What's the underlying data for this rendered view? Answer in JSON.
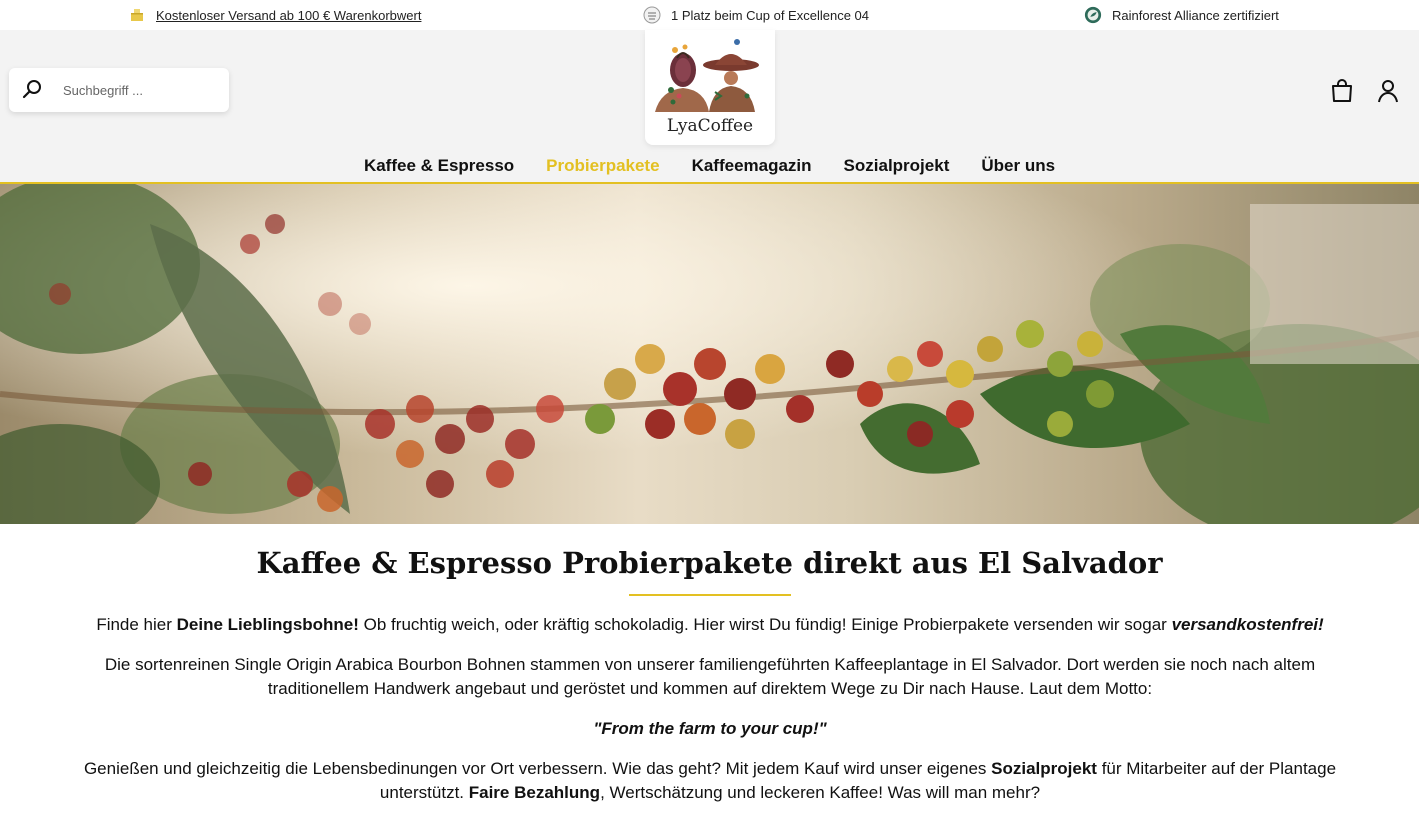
{
  "topbar": {
    "usp_shipping": "Kostenloser Versand ab 100 € Warenkorbwert",
    "usp_award": "1 Platz beim Cup of Excellence 04",
    "usp_rainforest": "Rainforest Alliance zertifiziert"
  },
  "header": {
    "search_placeholder": "Suchbegriff ...",
    "logo_text": "LyaCoffee"
  },
  "nav": {
    "items": [
      "Kaffee & Espresso",
      "Probierpakete",
      "Kaffeemagazin",
      "Sozialprojekt",
      "Über uns"
    ],
    "active": "Probierpakete"
  },
  "content": {
    "title": "Kaffee & Espresso Probierpakete direkt aus El Salvador",
    "p1": {
      "a": "Finde hier ",
      "b": "Deine Lieblingsbohne!",
      "c": " Ob fruchtig weich, oder kräftig schokoladig. Hier wirst Du fündig! Einige Probierpakete versenden wir sogar ",
      "d": "versandkostenfrei!"
    },
    "p2": "Die sortenreinen Single Origin Arabica Bourbon Bohnen stammen von unserer familiengeführten Kaffeeplantage in El Salvador. Dort werden sie noch nach altem traditionellem Handwerk angebaut und geröstet und kommen auf direktem Wege zu Dir nach Hause. Laut dem Motto:",
    "motto": "\"From the farm to your cup!\"",
    "p4": {
      "a": "Genießen und gleichzeitig die Lebensbedinungen vor Ort verbessern. Wie das geht? Mit jedem Kauf wird unser eigenes ",
      "b": "Sozialprojekt",
      "c": " für Mitarbeiter auf der Plantage unterstützt. ",
      "d": "Faire Bezahlung",
      "e": ", Wertschätzung und leckeren Kaffee! Was will man mehr?"
    }
  },
  "colors": {
    "accent": "#e3c022",
    "header_bg": "#f3f3f3"
  },
  "icons": [
    "shipping-icon",
    "award-icon",
    "rainforest-icon",
    "search-icon",
    "cart-icon",
    "account-icon"
  ]
}
